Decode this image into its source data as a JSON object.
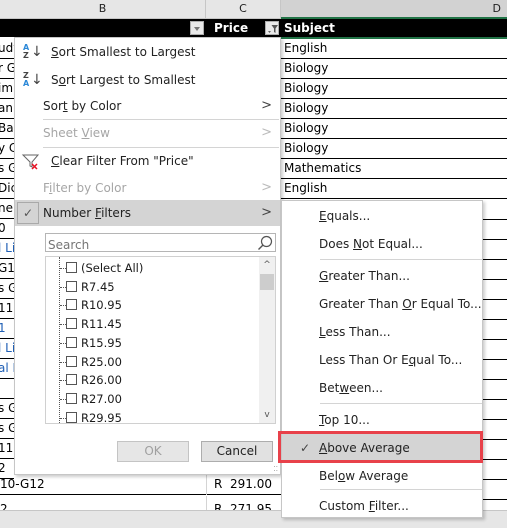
{
  "columns": {
    "B": "B",
    "C": "C",
    "D": "D"
  },
  "table_header": {
    "price": "Price",
    "subject": "Subject"
  },
  "column_b_peek": [
    {
      "text": "udy",
      "blue": false
    },
    {
      "text": "r G",
      "blue": false
    },
    {
      "text": "im",
      "blue": false
    },
    {
      "text": "an",
      "blue": false
    },
    {
      "text": "Bas",
      "blue": false
    },
    {
      "text": "y C",
      "blue": false
    },
    {
      "text": "s G",
      "blue": false
    },
    {
      "text": "Dic",
      "blue": false
    },
    {
      "text": "ne",
      "blue": false
    },
    {
      "text": "0",
      "blue": false
    },
    {
      "text": "l Li",
      "blue": true
    },
    {
      "text": "G1",
      "blue": false
    },
    {
      "text": "s G",
      "blue": false
    },
    {
      "text": "11",
      "blue": false
    },
    {
      "text": "1",
      "blue": true
    },
    {
      "text": "l Li",
      "blue": true
    },
    {
      "text": "al L",
      "blue": true
    },
    {
      "text": "",
      "blue": false
    },
    {
      "text": "s G",
      "blue": false
    },
    {
      "text": "s G",
      "blue": false
    },
    {
      "text": "11",
      "blue": false
    },
    {
      "text": "2",
      "blue": false
    }
  ],
  "subjects": [
    "English",
    "Biology",
    "Biology",
    "Biology",
    "Biology",
    "Biology",
    "Mathematics",
    "English"
  ],
  "bottom_rows": [
    {
      "b": "10-G12",
      "currency": "R",
      "price": "291.00"
    },
    {
      "b": "2",
      "currency": "R",
      "price": "271.95"
    }
  ],
  "filter_menu": {
    "sort_asc": {
      "pre": "",
      "u": "S",
      "post": "ort Smallest to Largest"
    },
    "sort_desc": {
      "pre": "S",
      "u": "o",
      "post": "rt Largest to Smallest"
    },
    "sort_color": {
      "pre": "Sor",
      "u": "t",
      "post": " by Color"
    },
    "sheet_view": {
      "pre": "Sheet ",
      "u": "V",
      "post": "iew"
    },
    "clear_filter": {
      "pre": "",
      "u": "C",
      "post": "lear Filter From \"Price\""
    },
    "filter_color": {
      "pre": "F",
      "u": "i",
      "post": "lter by Color"
    },
    "number_filters": {
      "pre": "Number ",
      "u": "F",
      "post": "ilters"
    },
    "search_placeholder": "Search",
    "values": [
      "(Select All)",
      "R7.45",
      "R10.95",
      "R11.45",
      "R15.95",
      "R25.00",
      "R26.00",
      "R27.00",
      "R29.95"
    ],
    "ok_label": "OK",
    "cancel_label": "Cancel"
  },
  "number_filters_submenu": [
    {
      "pre": "",
      "u": "E",
      "post": "quals...",
      "checked": false
    },
    {
      "pre": "Does ",
      "u": "N",
      "post": "ot Equal...",
      "checked": false
    },
    {
      "pre": "",
      "u": "G",
      "post": "reater Than...",
      "checked": false
    },
    {
      "pre": "Greater Than ",
      "u": "O",
      "post": "r Equal To...",
      "checked": false
    },
    {
      "pre": "",
      "u": "L",
      "post": "ess Than...",
      "checked": false
    },
    {
      "pre": "Less Than Or E",
      "u": "q",
      "post": "ual To...",
      "checked": false
    },
    {
      "pre": "Bet",
      "u": "w",
      "post": "een...",
      "checked": false
    },
    {
      "pre": "",
      "u": "T",
      "post": "op 10...",
      "checked": false
    },
    {
      "pre": "",
      "u": "A",
      "post": "bove Average",
      "checked": true
    },
    {
      "pre": "Bel",
      "u": "o",
      "post": "w Average",
      "checked": false
    },
    {
      "pre": "Custom ",
      "u": "F",
      "post": "ilter...",
      "checked": false
    }
  ],
  "colors": {
    "accent_green": "#217346",
    "highlight_red": "#e8414a",
    "sort_blue": "#2b88d8",
    "clear_red": "#e81123"
  }
}
